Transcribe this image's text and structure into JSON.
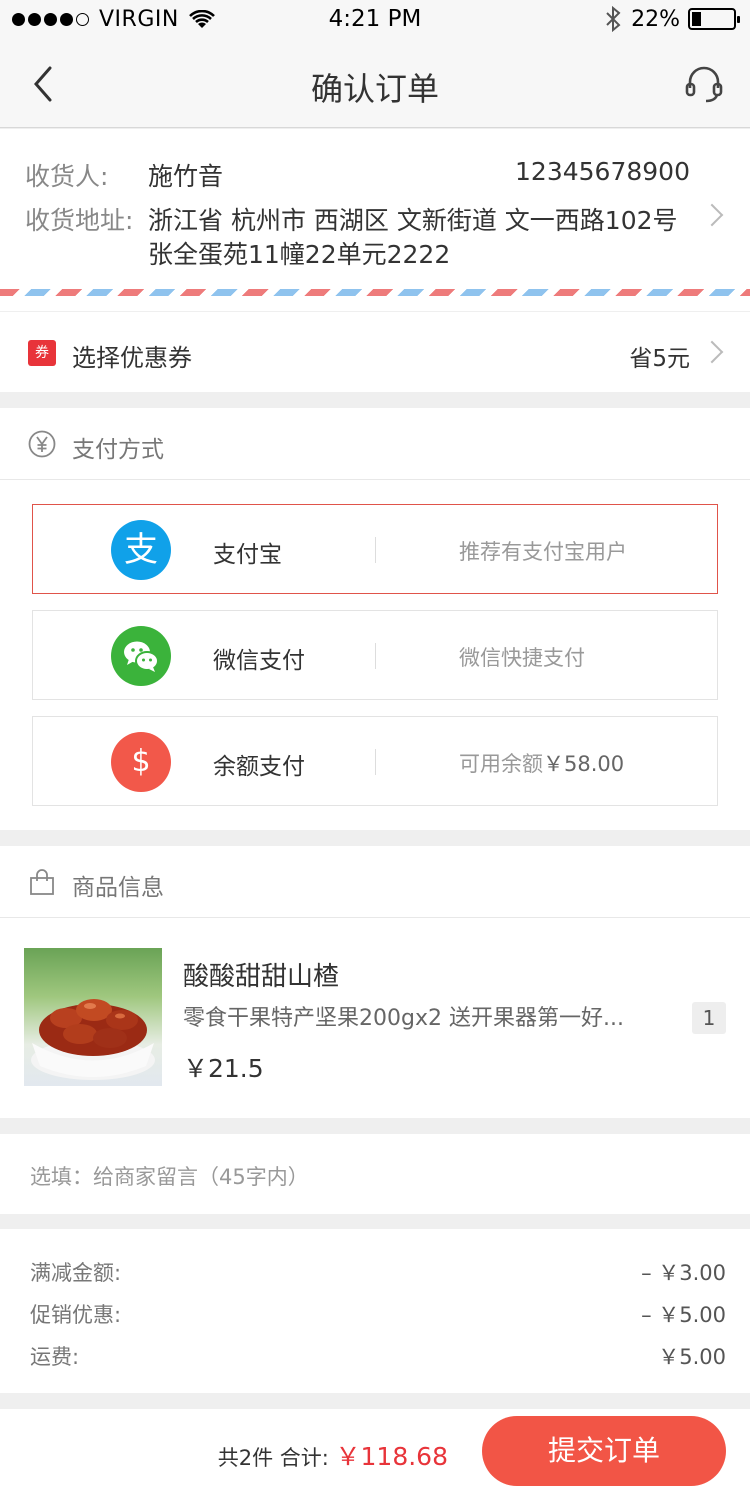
{
  "status_bar": {
    "carrier": "VIRGIN",
    "time": "4:21 PM",
    "battery_percent": "22%",
    "battery_level": 0.22
  },
  "nav": {
    "title": "确认订单",
    "back_icon": "chevron-left-icon",
    "service_icon": "headset-icon"
  },
  "address": {
    "consignee_label": "收货人:",
    "consignee_name": "施竹音",
    "phone": "12345678900",
    "address_label": "收货地址:",
    "address_line1": "浙江省 杭州市 西湖区 文新街道 文一西路102号",
    "address_line2": "张全蛋苑11幢22单元2222"
  },
  "coupon": {
    "tag": "券",
    "label": "选择优惠券",
    "savings": "省5元"
  },
  "payment": {
    "title": "支付方式",
    "icon": "yuan-circle-icon",
    "options": [
      {
        "name": "支付宝",
        "note": "推荐有支付宝用户",
        "color": "#10a1e9",
        "selected": true,
        "icon": "alipay-icon",
        "glyph": "支"
      },
      {
        "name": "微信支付",
        "note": "微信快捷支付",
        "color": "#3bb33b",
        "selected": false,
        "icon": "wechat-icon",
        "glyph": ""
      },
      {
        "name": "余额支付",
        "note": "可用余额",
        "amount": "￥58.00",
        "color": "#f2584a",
        "selected": false,
        "icon": "dollar-icon",
        "glyph": "$"
      }
    ]
  },
  "goods": {
    "title": "商品信息",
    "icon": "shopping-bag-icon",
    "item": {
      "name": "酸酸甜甜山楂",
      "desc": "零食干果特产坚果200gx2 送开果器第一好...",
      "price": "￥21.5",
      "qty": "1"
    }
  },
  "note": {
    "placeholder": "选填：给商家留言（45字内）"
  },
  "summary": {
    "rows": [
      {
        "label": "满减金额:",
        "value": "– ￥3.00"
      },
      {
        "label": "促销优惠:",
        "value": "– ￥5.00"
      },
      {
        "label": "运费:",
        "value": "￥5.00"
      }
    ]
  },
  "bottom": {
    "count_text": "共2件 合计:",
    "total": "￥118.68",
    "submit_label": "提交订单"
  },
  "colors": {
    "accent": "#f25546",
    "price_red": "#e8343a"
  }
}
